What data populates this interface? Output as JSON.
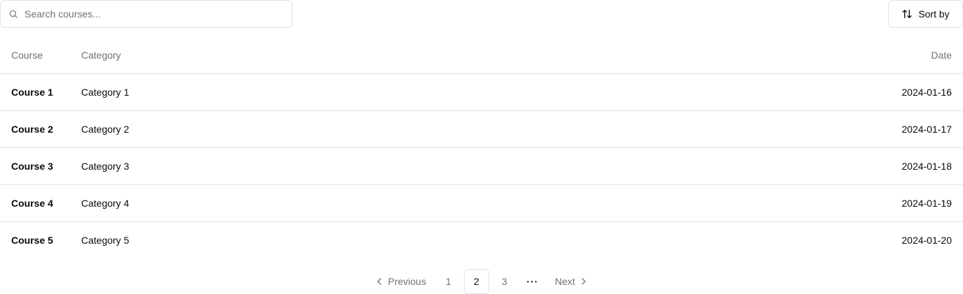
{
  "search": {
    "placeholder": "Search courses..."
  },
  "toolbar": {
    "sort_label": "Sort by"
  },
  "table": {
    "headers": {
      "course": "Course",
      "category": "Category",
      "date": "Date"
    },
    "rows": [
      {
        "course": "Course 1",
        "category": "Category 1",
        "date": "2024-01-16"
      },
      {
        "course": "Course 2",
        "category": "Category 2",
        "date": "2024-01-17"
      },
      {
        "course": "Course 3",
        "category": "Category 3",
        "date": "2024-01-18"
      },
      {
        "course": "Course 4",
        "category": "Category 4",
        "date": "2024-01-19"
      },
      {
        "course": "Course 5",
        "category": "Category 5",
        "date": "2024-01-20"
      }
    ]
  },
  "pagination": {
    "previous_label": "Previous",
    "next_label": "Next",
    "pages": [
      "1",
      "2",
      "3"
    ],
    "current_page": "2",
    "ellipsis": "···"
  },
  "colors": {
    "border": "#e4e4e7",
    "muted": "#71717a",
    "text": "#09090b"
  }
}
